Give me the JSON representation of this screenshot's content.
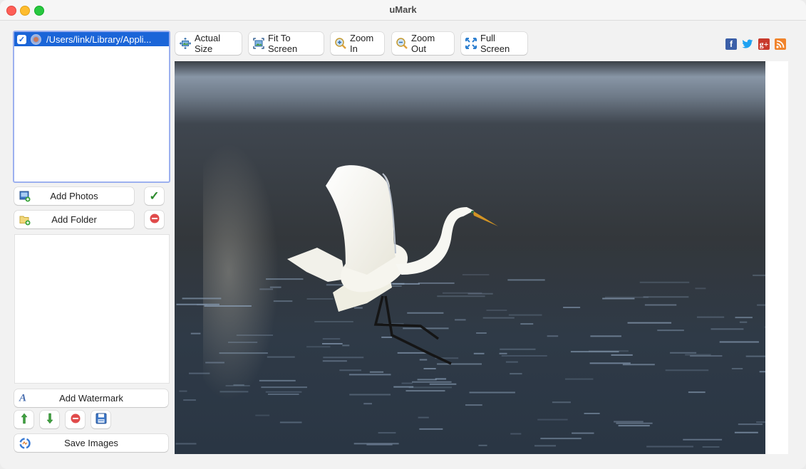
{
  "window": {
    "title": "uMark"
  },
  "file_list": {
    "items": [
      {
        "checked": true,
        "path": "/Users/link/Library/Appli..."
      }
    ]
  },
  "left_panel": {
    "add_photos_label": "Add Photos",
    "add_folder_label": "Add Folder",
    "add_watermark_label": "Add Watermark",
    "save_images_label": "Save Images",
    "icons": {
      "add_photos": "image-add-icon",
      "add_folder": "folder-add-icon",
      "check_all": "checkmark-icon",
      "remove": "remove-icon",
      "watermark": "text-watermark-icon",
      "move_up": "arrow-up-icon",
      "move_down": "arrow-down-icon",
      "delete_watermark": "remove-icon",
      "save_watermark": "floppy-disk-icon",
      "save_images": "save-images-icon"
    }
  },
  "toolbar": {
    "buttons": [
      {
        "label": "Actual Size",
        "icon": "actual-size-icon"
      },
      {
        "label": "Fit To Screen",
        "icon": "fit-to-screen-icon"
      },
      {
        "label": "Zoom In",
        "icon": "zoom-in-icon"
      },
      {
        "label": "Zoom Out",
        "icon": "zoom-out-icon"
      },
      {
        "label": "Full Screen",
        "icon": "full-screen-icon"
      }
    ],
    "social": [
      {
        "name": "facebook",
        "glyph": "f",
        "color": "#3b5fa8"
      },
      {
        "name": "twitter",
        "glyph": "t",
        "color": "#1da1f2"
      },
      {
        "name": "google-plus",
        "glyph": "g+",
        "color": "#c8392b"
      },
      {
        "name": "rss",
        "glyph": "rss",
        "color": "#f0842c"
      }
    ]
  },
  "preview": {
    "description": "Great egret landing on rippling water"
  },
  "colors": {
    "selection": "#1b65d8",
    "focus_ring": "#9cb0ef"
  }
}
